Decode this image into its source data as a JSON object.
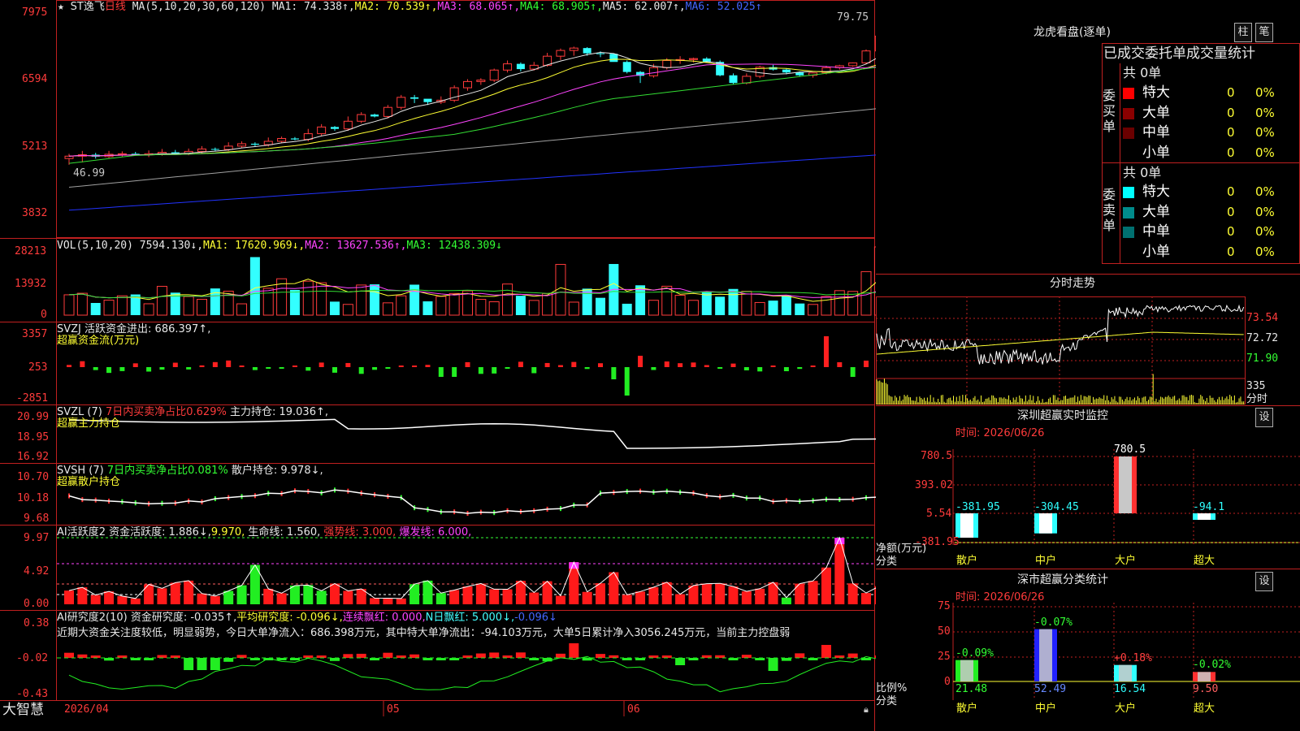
{
  "app": {
    "brand": "大智慧"
  },
  "colors": {
    "up": "#ff3b3b",
    "down": "#33ffff",
    "ma1": "#e8e8e8",
    "ma2": "#ffff33",
    "ma3": "#ff44ff",
    "ma4": "#33dd33",
    "ma5": "#a0a0a0",
    "ma6": "#2233ff",
    "panel_border": "#c02020"
  },
  "main": {
    "header": {
      "stock": "ST逸飞",
      "period": "日线",
      "ma_label": "MA(5,10,20,30,60,120)",
      "ma1": "MA1: 74.338↑,",
      "ma2": "MA2: 70.539↑,",
      "ma3": "MA3: 68.065↑,",
      "ma4": "MA4: 68.905↑,",
      "ma5": "MA5: 62.007↑,",
      "ma6": "MA6: 52.025↑"
    },
    "y_ticks": [
      "7975",
      "6594",
      "5213",
      "3832"
    ],
    "high_mark": "79.75",
    "low_mark": "46.99"
  },
  "vol": {
    "header": {
      "name": "VOL(5,10,20)",
      "v": "7594.130↓,",
      "ma1": "MA1: 17620.969↓,",
      "ma2": "MA2: 13627.536↑,",
      "ma3": "MA3: 12438.309↓"
    },
    "y_ticks": [
      "28213",
      "13932",
      "0"
    ]
  },
  "svzj": {
    "header": {
      "name": "SVZJ",
      "label": "活跃资金进出: 686.397↑,",
      "sub": "超赢资金流(万元)"
    },
    "y_ticks": [
      "3357",
      "253",
      "-2851"
    ]
  },
  "svzl": {
    "header": {
      "name": "SVZL (7)",
      "ratio": "7日内买卖净占比0.629%",
      "hold": "主力持仓: 19.036↑,",
      "sub": "超赢主力持仓"
    },
    "y_ticks": [
      "20.99",
      "18.95",
      "16.92"
    ]
  },
  "svsh": {
    "header": {
      "name": "SVSH (7)",
      "ratio": "7日内买卖净占比0.081%",
      "hold": "散户持仓: 9.978↓,",
      "sub": "超赢散户持仓"
    },
    "y_ticks": [
      "10.70",
      "10.18",
      "9.68"
    ]
  },
  "ai_active": {
    "header": {
      "name": "AI活跃度2",
      "a": "资金活跃度: 1.886↓,",
      "b": "9.970,",
      "c": "生命线: 1.560,",
      "d": "强势线: 3.000,",
      "e": "爆发线: 6.000,"
    },
    "y_ticks": [
      "9.97",
      "4.92",
      "0.00"
    ]
  },
  "ai_research": {
    "header": {
      "name": "AI研究度2(10)",
      "a": "资金研究度: -0.035↑,",
      "b": "平均研究度: -0.096↓,",
      "c": "连续飘红: 0.000,",
      "d": "N日飘红: 5.000↓,",
      "e": "-0.096↓"
    },
    "comment": "近期大资金关注度较低，明显弱势，今日大单净流入：686.398万元，其中特大单净流出：-94.103万元，大单5日累计净入3056.245万元，当前主力控盘弱",
    "y_ticks": [
      "0.38",
      "-0.02",
      "-0.43"
    ]
  },
  "xaxis": {
    "labels": [
      "2026/04",
      "05",
      "06"
    ]
  },
  "dragon": {
    "title": "龙虎看盘(逐单)",
    "btn1": "柱",
    "btn2": "笔",
    "subtitle": "已成交委托单成交量统计",
    "buy_label": "委买单",
    "sell_label": "委卖单",
    "buy_total": "共 0单",
    "sell_total": "共 0单",
    "buy_rows": [
      {
        "name": "特大",
        "count": "0",
        "pct": "0%",
        "color": "#ff0000"
      },
      {
        "name": "大单",
        "count": "0",
        "pct": "0%",
        "color": "#8b0000"
      },
      {
        "name": "中单",
        "count": "0",
        "pct": "0%",
        "color": "#6b0000"
      },
      {
        "name": "小单",
        "count": "0",
        "pct": "0%",
        "color": ""
      }
    ],
    "sell_rows": [
      {
        "name": "特大",
        "count": "0",
        "pct": "0%",
        "color": "#00ffff"
      },
      {
        "name": "大单",
        "count": "0",
        "pct": "0%",
        "color": "#008b8b"
      },
      {
        "name": "中单",
        "count": "0",
        "pct": "0%",
        "color": "#007070"
      },
      {
        "name": "小单",
        "count": "0",
        "pct": "0%",
        "color": ""
      }
    ]
  },
  "intraday": {
    "title": "分时走势",
    "y_ticks": [
      "73.54",
      "72.72",
      "71.90"
    ],
    "vol_tick": "335",
    "vol_label": "分时"
  },
  "sz_monitor": {
    "title": "深圳超赢实时监控",
    "btn": "设",
    "time": "时间: 2026/06/26",
    "y_ticks": [
      "780.5",
      "393.02",
      "5.54",
      "-381.95"
    ],
    "ylabel": "净额(万元)",
    "xlabel": "分类",
    "categories": [
      "散户",
      "中户",
      "大户",
      "超大"
    ],
    "values": [
      -381.95,
      -304.45,
      780.5,
      -94.1
    ],
    "value_labels": [
      "-381.95",
      "-304.45",
      "780.5",
      "-94.1"
    ]
  },
  "sz_class": {
    "title": "深市超赢分类统计",
    "btn": "设",
    "time": "时间: 2026/06/26",
    "y_ticks": [
      "75",
      "50",
      "25",
      "0"
    ],
    "ylabel": "比例%",
    "xlabel": "分类",
    "categories": [
      "散户",
      "中户",
      "大户",
      "超大"
    ],
    "values": [
      21.48,
      52.49,
      16.54,
      9.5
    ],
    "value_labels": [
      "21.48",
      "52.49",
      "16.54",
      "9.50"
    ],
    "changes": [
      "-0.09%",
      "-0.07%",
      "+0.18%",
      "-0.02%"
    ]
  },
  "chart_data": [
    {
      "type": "candlestick",
      "title": "ST逸飞 日线",
      "ylim": [
        38.32,
        79.75
      ],
      "x": "daily bars 2026/04 – 2026/06",
      "series": [
        {
          "name": "OHLC",
          "open": [
            50.0,
            50.5,
            50.8,
            50.4,
            50.9,
            51.0,
            50.8,
            51.0,
            51.3,
            51.0,
            51.5,
            52.0,
            51.9,
            52.6,
            53.1,
            52.9,
            53.6,
            54.2,
            54.0,
            55.2,
            56.6,
            56.2,
            57.8,
            59.2,
            58.8,
            60.7,
            62.8,
            62.5,
            61.8,
            62.2,
            64.8,
            66.1,
            66.4,
            68.5,
            69.8,
            68.7,
            69.5,
            71.4,
            72.6,
            73.1,
            72.0,
            71.9,
            70.2,
            68.1,
            67.3,
            69.0,
            70.5,
            70.7,
            70.9,
            70.2,
            67.4,
            65.8,
            67.2,
            69.1,
            68.6,
            68.0,
            67.4,
            67.9,
            69.0,
            69.4,
            70.0,
            72.5,
            75.6,
            77.8,
            76.1,
            75.0
          ],
          "high": [
            51.0,
            51.6,
            51.2,
            51.6,
            51.5,
            51.4,
            51.7,
            52.0,
            51.8,
            52.1,
            52.6,
            52.3,
            53.4,
            53.6,
            53.4,
            54.4,
            54.6,
            54.5,
            56.2,
            57.2,
            56.8,
            58.8,
            59.7,
            59.4,
            61.2,
            63.3,
            63.3,
            62.4,
            63.0,
            65.3,
            66.6,
            66.8,
            68.8,
            70.5,
            70.1,
            70.2,
            72.1,
            73.0,
            73.4,
            73.3,
            72.4,
            72.0,
            70.5,
            68.3,
            69.8,
            71.0,
            71.4,
            71.1,
            71.2,
            70.5,
            67.8,
            67.8,
            69.4,
            69.6,
            68.8,
            68.2,
            68.0,
            69.4,
            69.6,
            70.1,
            72.8,
            76.2,
            78.2,
            79.75,
            76.8,
            75.8
          ],
          "low": [
            48.7,
            49.2,
            50.0,
            50.1,
            50.4,
            50.6,
            50.3,
            50.6,
            50.9,
            50.7,
            51.1,
            51.5,
            51.6,
            52.2,
            52.6,
            52.5,
            53.2,
            53.8,
            53.6,
            54.8,
            55.8,
            55.8,
            57.4,
            58.6,
            58.4,
            60.2,
            61.6,
            61.2,
            61.4,
            61.8,
            64.2,
            65.4,
            66.0,
            68.0,
            68.2,
            68.4,
            69.2,
            70.6,
            71.5,
            71.5,
            71.2,
            71.4,
            67.8,
            65.8,
            66.9,
            68.6,
            69.8,
            70.1,
            70.4,
            67.2,
            65.5,
            65.5,
            66.8,
            68.4,
            67.6,
            67.2,
            66.9,
            67.6,
            68.6,
            69.2,
            69.8,
            72.2,
            75.2,
            75.6,
            74.5,
            74.0
          ],
          "close": [
            50.5,
            50.8,
            50.4,
            50.9,
            51.0,
            50.8,
            51.0,
            51.3,
            51.0,
            51.5,
            52.0,
            51.9,
            52.6,
            53.1,
            52.9,
            53.6,
            54.2,
            54.0,
            55.2,
            56.6,
            56.2,
            57.8,
            59.2,
            58.8,
            60.7,
            62.8,
            62.5,
            61.8,
            62.2,
            64.8,
            66.1,
            66.4,
            68.5,
            69.8,
            68.7,
            69.5,
            71.4,
            72.6,
            73.1,
            72.0,
            71.9,
            70.2,
            68.1,
            67.3,
            69.0,
            70.5,
            70.7,
            70.9,
            70.2,
            67.4,
            65.8,
            67.2,
            69.1,
            68.6,
            68.0,
            67.4,
            67.9,
            69.0,
            69.4,
            70.0,
            72.5,
            75.6,
            77.8,
            76.1,
            75.0,
            74.2
          ]
        }
      ]
    },
    {
      "type": "bar",
      "title": "深圳超赢实时监控",
      "ylabel": "净额(万元)",
      "xlabel": "分类",
      "categories": [
        "散户",
        "中户",
        "大户",
        "超大"
      ],
      "values": [
        -381.95,
        -304.45,
        780.5,
        -94.1
      ],
      "ylim": [
        -381.95,
        780.5
      ]
    },
    {
      "type": "bar",
      "title": "深市超赢分类统计",
      "ylabel": "比例%",
      "xlabel": "分类",
      "categories": [
        "散户",
        "中户",
        "大户",
        "超大"
      ],
      "values": [
        21.48,
        52.49,
        16.54,
        9.5
      ],
      "ylim": [
        0,
        75
      ]
    }
  ]
}
